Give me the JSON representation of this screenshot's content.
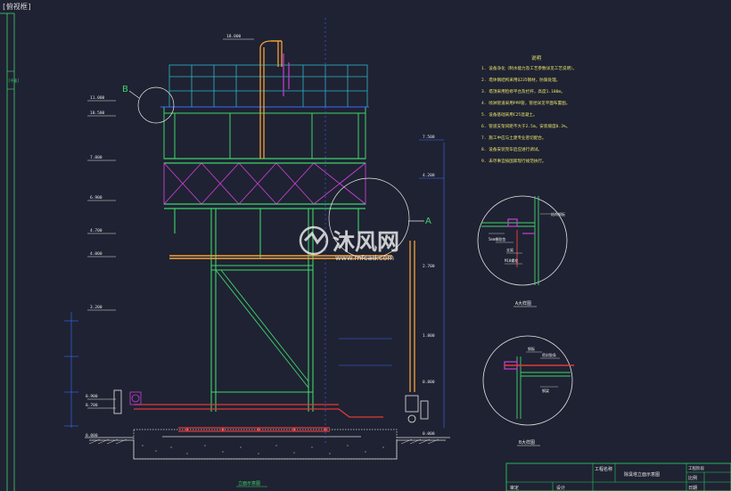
{
  "viewport_tag": "[俯视框]",
  "side_tab": "[平面]",
  "callouts": {
    "b_marker": "B",
    "a_marker": "A"
  },
  "elevation_labels": [
    "18.000",
    "11.000",
    "10.500",
    "7.800",
    "6.900",
    "4.700",
    "4.000",
    "3.200",
    "0.900",
    "0.700",
    "0.000"
  ],
  "right_labels": [
    "7.500",
    "4.200",
    "2.700",
    "1.800",
    "0.800",
    "0.000"
  ],
  "notes": {
    "title": "说明",
    "items": [
      "1. 设备净化（制水能力及工艺参数详见工艺说明）。",
      "2. 塔体钢结构采用Q235钢材，防腐处理。",
      "3. 塔顶采用检修平台及栏杆，高度1.100m。",
      "4. 喷淋管道采用PPR管，管径详见平面布置图。",
      "5. 设备基础采用C25混凝土。",
      "6. 管道支架间距不大于2.5m，安装坡度0.3%。",
      "7. 施工中应与土建专业密切配合。",
      "8. 设备安装完毕后应进行调试。",
      "9. 未尽事宜按国家现行规范执行。"
    ]
  },
  "detail_a": {
    "caption": "A大样图",
    "labels": [
      "结构钢板",
      "5mm橡胶垫",
      "支架",
      "M10螺栓"
    ]
  },
  "detail_b": {
    "caption": "B大样图",
    "labels": [
      "钢板",
      "密封胶条",
      "钢梁"
    ]
  },
  "main_caption": "立面示意图",
  "watermark": {
    "brand": "沐风网",
    "url": "www.mfcad.com"
  },
  "title_block": {
    "project_label": "工程名称",
    "drawing_title": "除臭塔立面示意图",
    "scale_label": "比例",
    "date_label": "日期",
    "stage_label": "工程阶段",
    "design_label": "设计",
    "review_label": "审定"
  },
  "colors": {
    "background": "#1f2232",
    "structure_green": "#3fd46b",
    "pipe_yellow": "#f2a23b",
    "brace_magenta": "#c93fd6",
    "dimension_blue": "#3a6cff",
    "ground_white": "#d8d8d8",
    "pipe_red": "#e03a3a",
    "title_green": "#24c85a"
  }
}
